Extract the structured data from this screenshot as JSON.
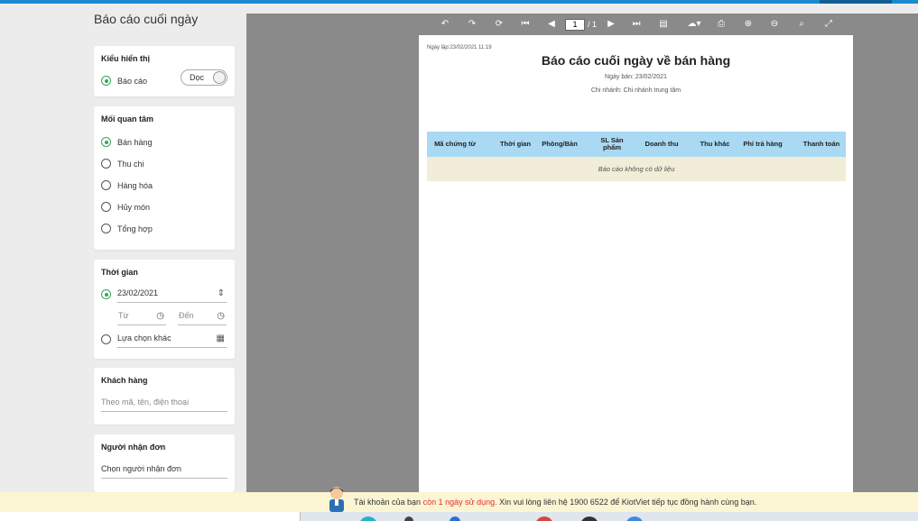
{
  "page": {
    "title": "Báo cáo cuối ngày"
  },
  "display": {
    "heading": "Kiểu hiển thị",
    "option_label": "Báo cáo",
    "toggle_label": "Dọc"
  },
  "interest": {
    "heading": "Mối quan tâm",
    "options": [
      "Bán hàng",
      "Thu chi",
      "Hàng hóa",
      "Hủy món",
      "Tổng hợp"
    ],
    "selected": "Bán hàng"
  },
  "time": {
    "heading": "Thời gian",
    "date_value": "23/02/2021",
    "from_placeholder": "Từ",
    "to_placeholder": "Đến",
    "other_label": "Lựa chọn khác"
  },
  "customer": {
    "heading": "Khách hàng",
    "placeholder": "Theo mã, tên, điện thoại"
  },
  "receiver": {
    "heading": "Người nhận đơn",
    "placeholder": "Chọn người nhận đơn"
  },
  "viewer": {
    "page_current": "1",
    "page_total": "/ 1"
  },
  "report": {
    "created": "Ngày lập:23/02/2021 11:19",
    "title": "Báo cáo cuối ngày về bán hàng",
    "sale_date": "Ngày bán: 23/02/2021",
    "branch": "Chi nhánh: Chi nhánh trung tâm",
    "columns": [
      "Mã chứng từ",
      "Thời gian",
      "Phòng/Bàn",
      "SL Sản phẩm",
      "Doanh thu",
      "Thu khác",
      "Phí trả hàng",
      "Thanh toán"
    ],
    "empty_text": "Báo cáo không có dữ liệu"
  },
  "notice": {
    "prefix": "Tài khoản của bạn ",
    "highlight": "còn 1 ngày sử dụng.",
    "suffix": " Xin vui lòng liên hệ 1900 6522 để KiotViet tiếp tục đồng hành cùng bạn."
  },
  "colors": {
    "accent_green": "#3aa55a",
    "table_header": "#a9d9f3",
    "table_empty": "#f1edd8",
    "viewer_bg": "#8a8a8a",
    "notice_bg": "#fbf5d3",
    "notice_red": "#e0312b",
    "topbar_blue": "#1a8bd0"
  }
}
